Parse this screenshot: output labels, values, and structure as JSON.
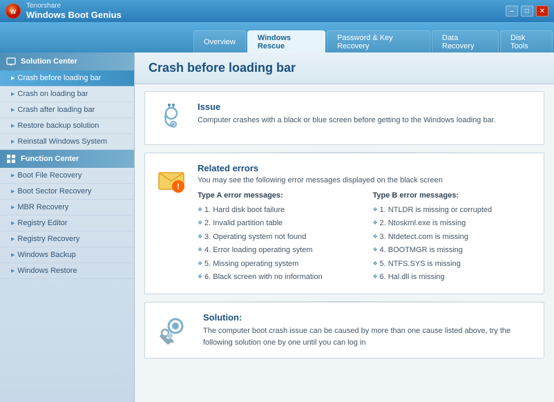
{
  "titleBar": {
    "brand": "Tenorshare",
    "product": "Windows Boot Genius",
    "minimize": "–",
    "maximize": "□",
    "close": "✕"
  },
  "tabs": [
    {
      "id": "overview",
      "label": "Overview",
      "active": false
    },
    {
      "id": "windows-rescue",
      "label": "Windows Rescue",
      "active": true
    },
    {
      "id": "password-key-recovery",
      "label": "Password & Key Recovery",
      "active": false
    },
    {
      "id": "data-recovery",
      "label": "Data Recovery",
      "active": false
    },
    {
      "id": "disk-tools",
      "label": "Disk Tools",
      "active": false
    }
  ],
  "sidebar": {
    "solutionCenter": {
      "label": "Solution Center",
      "items": [
        {
          "id": "crash-before",
          "label": "Crash before loading bar",
          "active": true
        },
        {
          "id": "crash-on",
          "label": "Crash on loading bar",
          "active": false
        },
        {
          "id": "crash-after",
          "label": "Crash after loading bar",
          "active": false
        },
        {
          "id": "restore-backup",
          "label": "Restore backup solution",
          "active": false
        },
        {
          "id": "reinstall-windows",
          "label": "Reinstall Windows System",
          "active": false
        }
      ]
    },
    "functionCenter": {
      "label": "Function Center",
      "items": [
        {
          "id": "boot-file",
          "label": "Boot File Recovery",
          "active": false
        },
        {
          "id": "boot-sector",
          "label": "Boot Sector Recovery",
          "active": false
        },
        {
          "id": "mbr-recovery",
          "label": "MBR Recovery",
          "active": false
        },
        {
          "id": "registry-editor",
          "label": "Registry Editor",
          "active": false
        },
        {
          "id": "registry-recovery",
          "label": "Registry Recovery",
          "active": false
        },
        {
          "id": "windows-backup",
          "label": "Windows Backup",
          "active": false
        },
        {
          "id": "windows-restore",
          "label": "Windows Restore",
          "active": false
        }
      ]
    }
  },
  "content": {
    "title": "Crash before loading bar",
    "issueSection": {
      "heading": "Issue",
      "description": "Computer crashes with a black or blue screen before getting to the Windows loading bar."
    },
    "relatedErrorsSection": {
      "heading": "Related errors",
      "subtitle": "You may see the following error messages displayed on the black screen",
      "columnATitle": "Type A error messages:",
      "columnBTitle": "Type B error messages:",
      "columnA": [
        "1. Hard disk boot failure",
        "2. Invalid partition table",
        "3. Operating system not found",
        "4. Error loading operating sytem",
        "5. Missing operating system",
        "6. Black screen with no information"
      ],
      "columnB": [
        "1. NTLDR is missing or corrupted",
        "2. Ntoskrnl.exe is missing",
        "3. Ntdetect.com is missing",
        "4. BOOTMGR is missing",
        "5. NTFS.SYS is missing",
        "6. Hal.dll is missing"
      ]
    },
    "solutionSection": {
      "heading": "Solution:",
      "description": "The computer boot crash issue can be caused by more than one cause listed above, try the following solution one by one until you can log in"
    }
  }
}
